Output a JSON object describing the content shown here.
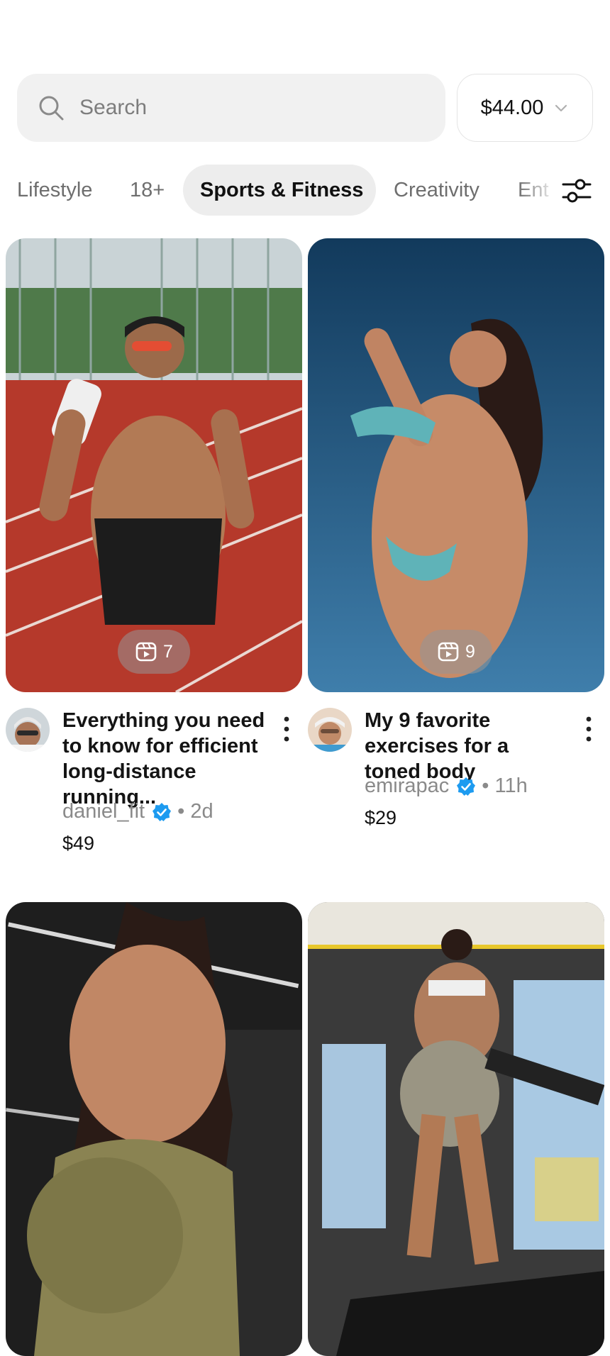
{
  "search": {
    "placeholder": "Search"
  },
  "balance": {
    "amount": "$44.00"
  },
  "categories": [
    {
      "label": "Lifestyle"
    },
    {
      "label": "18+"
    },
    {
      "label": "Sports & Fitness",
      "active": true
    },
    {
      "label": "Creativity"
    },
    {
      "label": "Ent"
    }
  ],
  "posts": [
    {
      "title": "Everything you need to know for efficient long-distance running...",
      "author": "daniel_fit",
      "age": "2d",
      "price": "$49",
      "media_count": "7",
      "verified": true
    },
    {
      "title": "My 9 favorite exercises for a toned body",
      "author": "emirapac",
      "age": "11h",
      "price": "$29",
      "media_count": "9",
      "verified": true
    },
    {
      "title": "",
      "author": "",
      "age": "",
      "price": ""
    },
    {
      "title": "",
      "author": "",
      "age": "",
      "price": ""
    }
  ],
  "icons": {
    "search": "search-icon",
    "chevron": "chevron-down-icon",
    "filter": "sliders-icon",
    "media": "reel-icon",
    "more": "more-vertical-icon",
    "verified": "verified-badge-icon"
  },
  "colors": {
    "accent_verified": "#1d9bf0",
    "track_red": "#b5392b",
    "sky_blue": "#1f5a86"
  }
}
